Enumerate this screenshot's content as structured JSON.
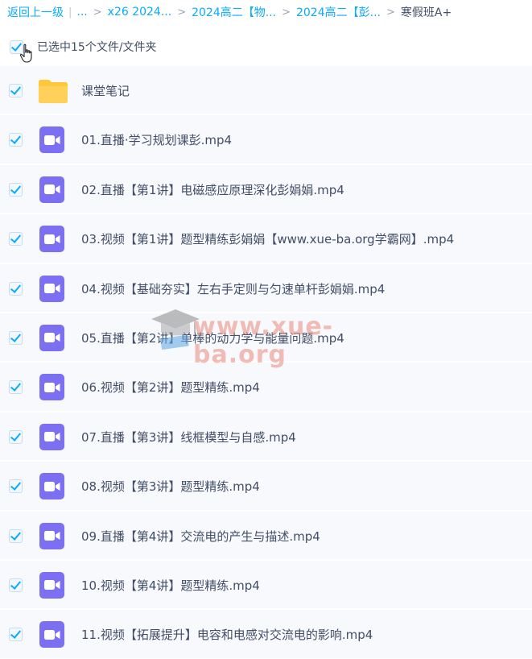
{
  "breadcrumb": {
    "back_label": "返回上一级",
    "divider": "|",
    "ellipsis": "...",
    "sep": ">",
    "crumbs": [
      "x26 2024...",
      "2024高二【物...",
      "2024高二【彭..."
    ],
    "current": "寒假班A+"
  },
  "selection": {
    "label": "已选中15个文件/文件夹"
  },
  "files": [
    {
      "name": "课堂笔记",
      "icon": "folder-icon"
    },
    {
      "name": "01.直播·学习规划课彭.mp4",
      "icon": "video-file-icon"
    },
    {
      "name": "02.直播【第1讲】电磁感应原理深化彭娟娟.mp4",
      "icon": "video-file-icon"
    },
    {
      "name": "03.视频【第1讲】题型精练彭娟娟【www.xue-ba.org学霸网】.mp4",
      "icon": "video-file-icon"
    },
    {
      "name": "04.视频【基础夯实】左右手定则与匀速单杆彭娟娟.mp4",
      "icon": "video-file-icon"
    },
    {
      "name": "05.直播【第2讲】单棒的动力学与能量问题.mp4",
      "icon": "video-file-icon"
    },
    {
      "name": "06.视频【第2讲】题型精练.mp4",
      "icon": "video-file-icon"
    },
    {
      "name": "07.直播【第3讲】线框模型与自感.mp4",
      "icon": "video-file-icon"
    },
    {
      "name": "08.视频【第3讲】题型精练.mp4",
      "icon": "video-file-icon"
    },
    {
      "name": "09.直播【第4讲】交流电的产生与描述.mp4",
      "icon": "video-file-icon"
    },
    {
      "name": "10.视频【第4讲】题型精练.mp4",
      "icon": "video-file-icon"
    },
    {
      "name": "11.视频【拓展提升】电容和电感对交流电的影响.mp4",
      "icon": "video-file-icon"
    }
  ],
  "watermark": {
    "text": "www.xue-ba.org"
  },
  "colors": {
    "link": "#09aaff",
    "video_icon": "#7c6ff2",
    "folder": "#ffc73a",
    "row_bg": "#f7f9fc"
  }
}
